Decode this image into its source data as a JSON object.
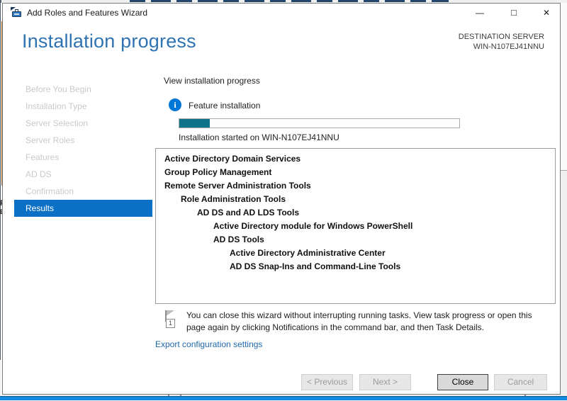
{
  "window": {
    "title": "Add Roles and Features Wizard",
    "controls": {
      "minimize": "—",
      "maximize": "□",
      "close": "✕"
    }
  },
  "header": {
    "title": "Installation progress",
    "destination_label": "DESTINATION SERVER",
    "destination_server": "WIN-N107EJ41NNU"
  },
  "sidebar": {
    "items": [
      "Before You Begin",
      "Installation Type",
      "Server Selection",
      "Server Roles",
      "Features",
      "AD DS",
      "Confirmation",
      "Results"
    ],
    "selected": "Results"
  },
  "main": {
    "view_label": "View installation progress",
    "feature_installation": {
      "info_icon_glyph": "i",
      "label": "Feature installation",
      "progress_percent": 11,
      "status": "Installation started on WIN-N107EJ41NNU"
    },
    "install_items": [
      {
        "label": "Active Directory Domain Services",
        "indent": 0
      },
      {
        "label": "Group Policy Management",
        "indent": 0
      },
      {
        "label": "Remote Server Administration Tools",
        "indent": 0
      },
      {
        "label": "Role Administration Tools",
        "indent": 1
      },
      {
        "label": "AD DS and AD LDS Tools",
        "indent": 2
      },
      {
        "label": "Active Directory module for Windows PowerShell",
        "indent": 3
      },
      {
        "label": "AD DS Tools",
        "indent": 3
      },
      {
        "label": "Active Directory Administrative Center",
        "indent": 4
      },
      {
        "label": "AD DS Snap-Ins and Command-Line Tools",
        "indent": 4
      }
    ],
    "note": {
      "badge": "1",
      "text": "You can close this wizard without interrupting running tasks. View task progress or open this page again by clicking Notifications in the command bar, and then Task Details."
    },
    "export_link": "Export configuration settings"
  },
  "buttons": {
    "previous": "< Previous",
    "next": "Next >",
    "close": "Close",
    "cancel": "Cancel"
  },
  "colors": {
    "title_blue": "#2f73b2",
    "selected_item_blue": "#0a70c6",
    "progress_teal": "#0f7389",
    "info_icon_blue": "#0076d7",
    "link_blue": "#1f67ac",
    "taskbar_blue": "#1389e2"
  }
}
